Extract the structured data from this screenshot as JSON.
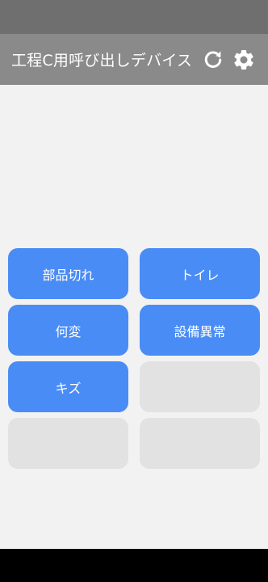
{
  "app": {
    "title": "工程C用呼び出しデバイス"
  },
  "icons": {
    "refresh": "refresh-icon",
    "settings": "gear-icon"
  },
  "colors": {
    "accent": "#4a8cf5",
    "app_bar": "#8a8a8a",
    "empty_slot": "#e2e2e2",
    "background": "#f2f2f2"
  },
  "buttons": [
    {
      "label": "部品切れ"
    },
    {
      "label": "トイレ"
    },
    {
      "label": "何変"
    },
    {
      "label": "設備異常"
    },
    {
      "label": "キズ"
    },
    {
      "label": ""
    },
    {
      "label": ""
    },
    {
      "label": ""
    }
  ]
}
